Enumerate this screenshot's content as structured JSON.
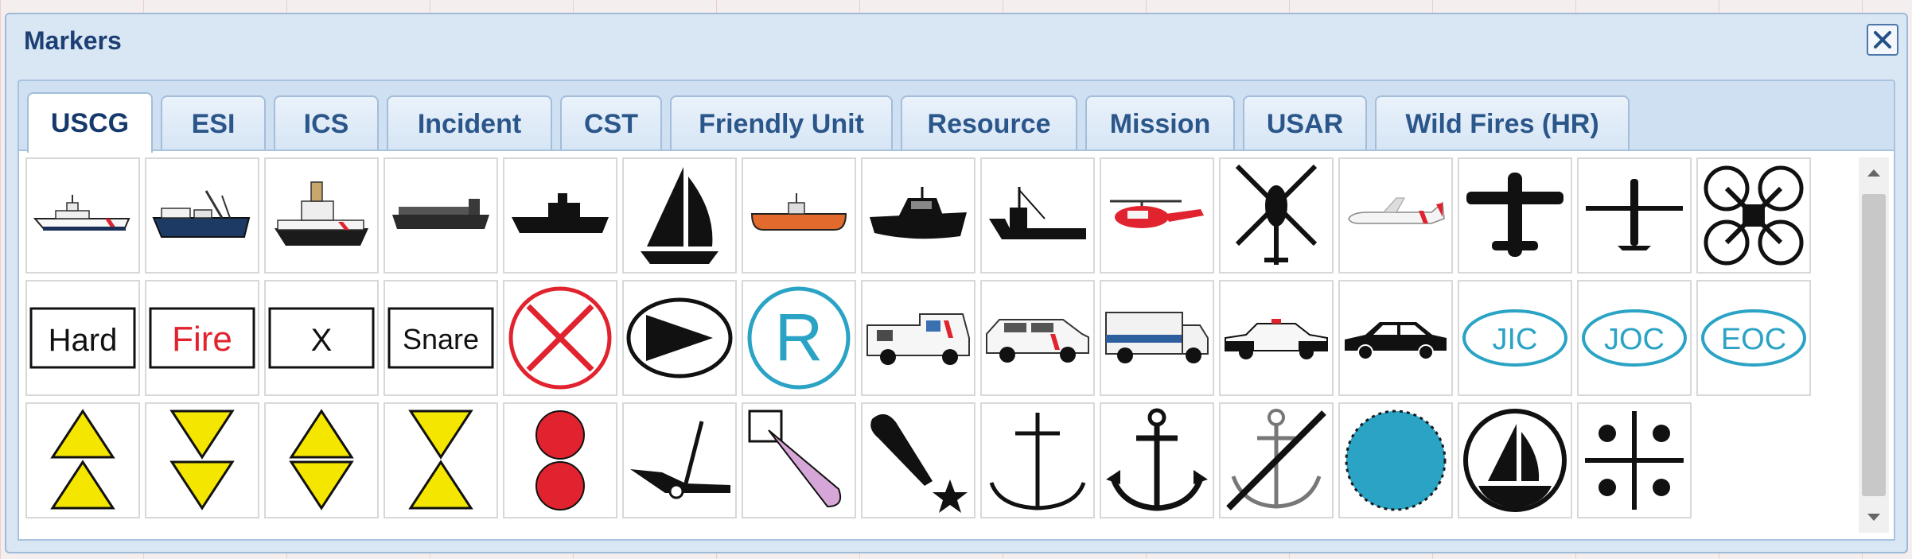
{
  "dialog": {
    "title": "Markers",
    "close_icon": "close-icon"
  },
  "tabs": [
    {
      "label": "USCG",
      "active": true
    },
    {
      "label": "ESI",
      "active": false
    },
    {
      "label": "ICS",
      "active": false
    },
    {
      "label": "Incident",
      "active": false
    },
    {
      "label": "CST",
      "active": false
    },
    {
      "label": "Friendly Unit",
      "active": false
    },
    {
      "label": "Resource",
      "active": false
    },
    {
      "label": "Mission",
      "active": false
    },
    {
      "label": "USAR",
      "active": false
    },
    {
      "label": "Wild Fires (HR)",
      "active": false
    }
  ],
  "markers": {
    "row1": [
      "cutter-icon",
      "buoy-tender-icon",
      "icebreaker-icon",
      "cargo-ship-icon",
      "tug-silhouette-icon",
      "sailboat-icon",
      "rigid-inflatable-boat-icon",
      "patrol-boat-icon",
      "fishing-vessel-icon",
      "red-helicopter-icon",
      "helicopter-silhouette-icon",
      "coast-guard-airplane-icon",
      "airplane-silhouette-icon",
      "drone-fixed-wing-icon",
      "quadcopter-icon"
    ],
    "row2": [
      "hard-label-icon",
      "fire-label-icon",
      "x-label-icon",
      "snare-label-icon",
      "red-x-circle-icon",
      "pennant-oval-icon",
      "r-circle-icon",
      "ambulance-icon",
      "suv-icon",
      "command-truck-icon",
      "police-car-icon",
      "sedan-icon",
      "jic-icon",
      "joc-icon",
      "eoc-icon"
    ],
    "row3": [
      "double-triangle-up-icon",
      "double-triangle-down-icon",
      "triangle-diamond-icon",
      "triangle-hourglass-icon",
      "two-red-circles-icon",
      "anchor-drag-icon",
      "square-cone-icon",
      "comet-star-icon",
      "anchor-line-icon",
      "anchor-icon",
      "no-anchoring-icon",
      "blue-dotted-circle-icon",
      "sailboat-circle-icon",
      "dots-cross-icon"
    ]
  },
  "marker_labels": {
    "hard": "Hard",
    "fire": "Fire",
    "x": "X",
    "snare": "Snare",
    "r": "R",
    "jic": "JIC",
    "joc": "JOC",
    "eoc": "EOC"
  },
  "colors": {
    "title": "#1d3f73",
    "tab_text": "#2b568a",
    "dialog_bg": "#d9e7f5",
    "red": "#e0232e",
    "teal": "#2aa3c5",
    "yellow": "#f5e600",
    "pink": "#d7a6d8"
  }
}
